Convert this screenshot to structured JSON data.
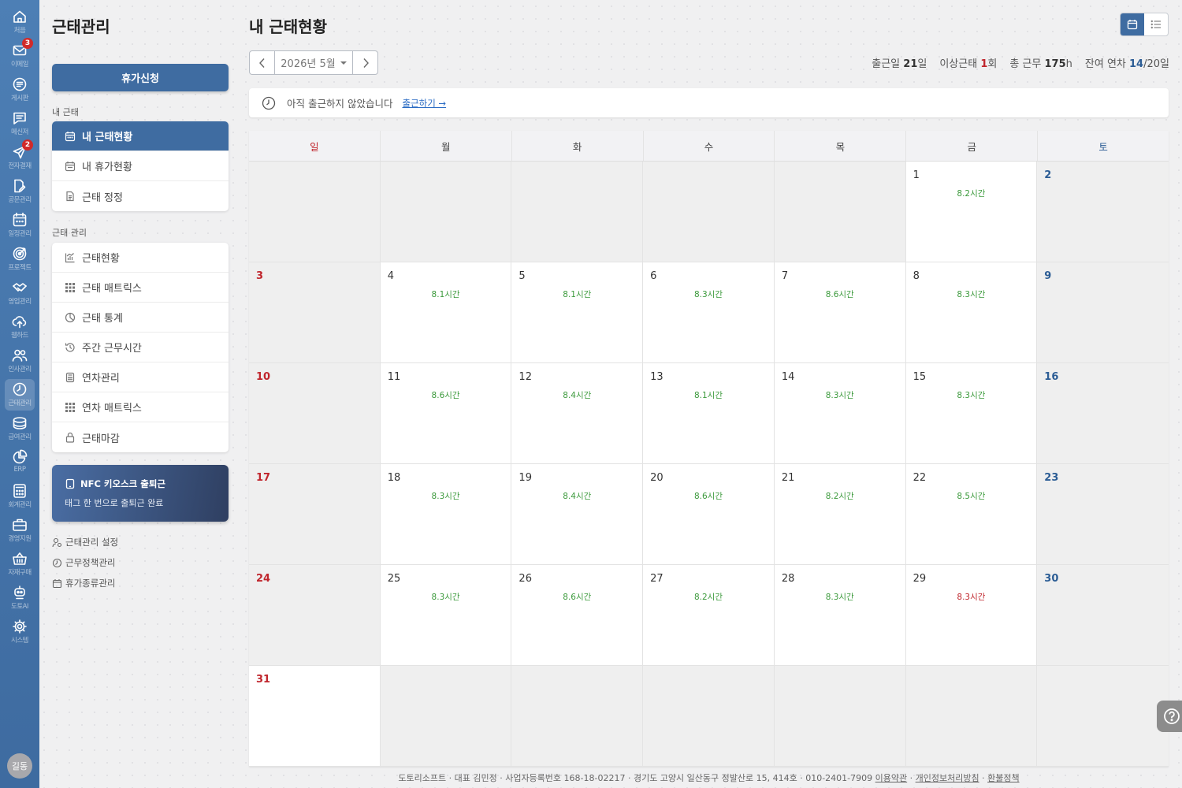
{
  "rail": [
    {
      "label": "처음",
      "icon": "home-icon"
    },
    {
      "label": "이메일",
      "icon": "mail-icon",
      "badge": "3"
    },
    {
      "label": "게시판",
      "icon": "board-icon"
    },
    {
      "label": "메신저",
      "icon": "chat-icon"
    },
    {
      "label": "전자결재",
      "icon": "send-icon",
      "badge": "2"
    },
    {
      "label": "공문관리",
      "icon": "doc-edit-icon"
    },
    {
      "label": "일정관리",
      "icon": "calendar-icon"
    },
    {
      "label": "프로젝트",
      "icon": "target-icon"
    },
    {
      "label": "영업관리",
      "icon": "handshake-icon"
    },
    {
      "label": "웹하드",
      "icon": "cloud-upload-icon"
    },
    {
      "label": "인사관리",
      "icon": "people-icon"
    },
    {
      "label": "근태관리",
      "icon": "clock-icon",
      "active": true
    },
    {
      "label": "급여관리",
      "icon": "coins-icon"
    },
    {
      "label": "ERP",
      "icon": "pie-icon"
    },
    {
      "label": "회계관리",
      "icon": "calculator-icon"
    },
    {
      "label": "경영지원",
      "icon": "briefcase-icon"
    },
    {
      "label": "자재구매",
      "icon": "basket-icon"
    },
    {
      "label": "도토AI",
      "icon": "robot-icon"
    },
    {
      "label": "시스템",
      "icon": "gear-icon"
    }
  ],
  "avatar": "길동",
  "side": {
    "title": "근태관리",
    "leave_button": "휴가신청",
    "my_section": "내 근태",
    "my_items": [
      "내 근태현황",
      "내 휴가현황",
      "근태 정정"
    ],
    "admin_section": "근태 관리",
    "admin_items": [
      "근태현황",
      "근태 매트릭스",
      "근태 통계",
      "주간 근무시간",
      "연차관리",
      "연차 매트릭스",
      "근태마감"
    ],
    "nfc_title": "NFC 키오스크 출퇴근",
    "nfc_sub": "태그 한 번으로 출퇴근 완료",
    "settings": [
      "근태관리 설정",
      "근무정책관리",
      "휴가종류관리"
    ]
  },
  "main": {
    "title": "내 근태현황",
    "month": "2026년 5월",
    "stats": {
      "attend_label": "출근일",
      "attend_value": "21",
      "attend_unit": "일",
      "abnormal_label": "이상근태",
      "abnormal_value": "1",
      "abnormal_unit": "회",
      "total_label": "총 근무",
      "total_value": "175",
      "total_unit": "h",
      "leave_label": "잔여 연차",
      "leave_value": "14",
      "leave_unit": "/20일"
    },
    "notice": "아직 출근하지 않았습니다",
    "notice_link": "출근하기 →",
    "weekdays": [
      "일",
      "월",
      "화",
      "수",
      "목",
      "금",
      "토"
    ]
  },
  "calendar": [
    {
      "d": "",
      "g": true
    },
    {
      "d": "",
      "g": true
    },
    {
      "d": "",
      "g": true
    },
    {
      "d": "",
      "g": true
    },
    {
      "d": "",
      "g": true
    },
    {
      "d": "1",
      "h": "8.2시간"
    },
    {
      "d": "2",
      "g": true
    },
    {
      "d": "3",
      "g": true
    },
    {
      "d": "4",
      "h": "8.1시간"
    },
    {
      "d": "5",
      "h": "8.1시간"
    },
    {
      "d": "6",
      "h": "8.3시간"
    },
    {
      "d": "7",
      "h": "8.6시간"
    },
    {
      "d": "8",
      "h": "8.3시간"
    },
    {
      "d": "9",
      "g": true
    },
    {
      "d": "10",
      "g": true
    },
    {
      "d": "11",
      "h": "8.6시간"
    },
    {
      "d": "12",
      "h": "8.4시간"
    },
    {
      "d": "13",
      "h": "8.1시간"
    },
    {
      "d": "14",
      "h": "8.3시간"
    },
    {
      "d": "15",
      "h": "8.3시간"
    },
    {
      "d": "16",
      "g": true
    },
    {
      "d": "17",
      "g": true
    },
    {
      "d": "18",
      "h": "8.3시간"
    },
    {
      "d": "19",
      "h": "8.4시간"
    },
    {
      "d": "20",
      "h": "8.6시간"
    },
    {
      "d": "21",
      "h": "8.2시간"
    },
    {
      "d": "22",
      "h": "8.5시간"
    },
    {
      "d": "23",
      "g": true
    },
    {
      "d": "24",
      "g": true
    },
    {
      "d": "25",
      "h": "8.3시간"
    },
    {
      "d": "26",
      "h": "8.6시간"
    },
    {
      "d": "27",
      "h": "8.2시간"
    },
    {
      "d": "28",
      "h": "8.3시간"
    },
    {
      "d": "29",
      "h": "8.3시간",
      "warn": true
    },
    {
      "d": "30",
      "g": true
    },
    {
      "d": "31"
    },
    {
      "d": "",
      "g": true
    },
    {
      "d": "",
      "g": true
    },
    {
      "d": "",
      "g": true
    },
    {
      "d": "",
      "g": true
    },
    {
      "d": "",
      "g": true
    },
    {
      "d": "",
      "g": true
    }
  ],
  "footer": {
    "text": "도토리소프트 · 대표 김민정 · 사업자등록번호 168-18-02217 · 경기도 고양시 일산동구 정발산로 15, 414호 · 010-2401-7909",
    "terms": "이용약관",
    "privacy": "개인정보처리방침",
    "refund": "환불정책"
  },
  "colors": {
    "brand": "#3f6ca1",
    "sunday": "#c0262d",
    "saturday": "#2c5d95",
    "hours": "#3c9a3c"
  }
}
